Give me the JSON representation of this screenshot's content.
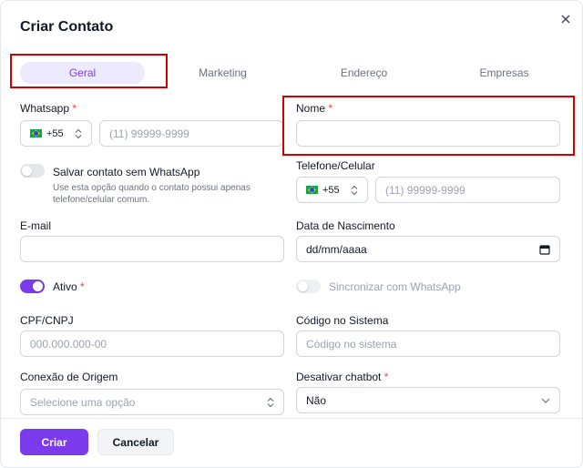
{
  "modal": {
    "title": "Criar Contato"
  },
  "tabs": [
    {
      "label": "Geral",
      "active": true
    },
    {
      "label": "Marketing",
      "active": false
    },
    {
      "label": "Endereço",
      "active": false
    },
    {
      "label": "Empresas",
      "active": false
    }
  ],
  "whatsapp": {
    "label": "Whatsapp",
    "required": "*",
    "country_code": "+55",
    "placeholder": "(11) 99999-9999"
  },
  "nome": {
    "label": "Nome",
    "required": "*",
    "value": ""
  },
  "save_without_whatsapp": {
    "label": "Salvar contato sem WhatsApp",
    "help": "Use esta opção quando o contato possui apenas telefone/celular comum.",
    "on": false
  },
  "telefone": {
    "label": "Telefone/Celular",
    "country_code": "+55",
    "placeholder": "(11) 99999-9999"
  },
  "email": {
    "label": "E-mail",
    "value": ""
  },
  "nascimento": {
    "label": "Data de Nascimento",
    "placeholder": "dd/mm/aaaa"
  },
  "ativo": {
    "label": "Ativo",
    "required": "*",
    "on": true
  },
  "sincronizar": {
    "label": "Sincronizar com WhatsApp",
    "on": false
  },
  "cpf": {
    "label": "CPF/CNPJ",
    "placeholder": "000.000.000-00"
  },
  "codigo": {
    "label": "Código no Sistema",
    "placeholder": "Código no sistema"
  },
  "conexao": {
    "label": "Conexão de Origem",
    "placeholder": "Selecione uma opção"
  },
  "chatbot": {
    "label": "Desativar chatbot",
    "required": "*",
    "value": "Não"
  },
  "actions": {
    "create_label": "Criar",
    "cancel_label": "Cancelar"
  },
  "colors": {
    "accent": "#7c3aed",
    "accent_soft": "#ede9fe",
    "required": "#ef4444",
    "highlight": "#d40000"
  }
}
